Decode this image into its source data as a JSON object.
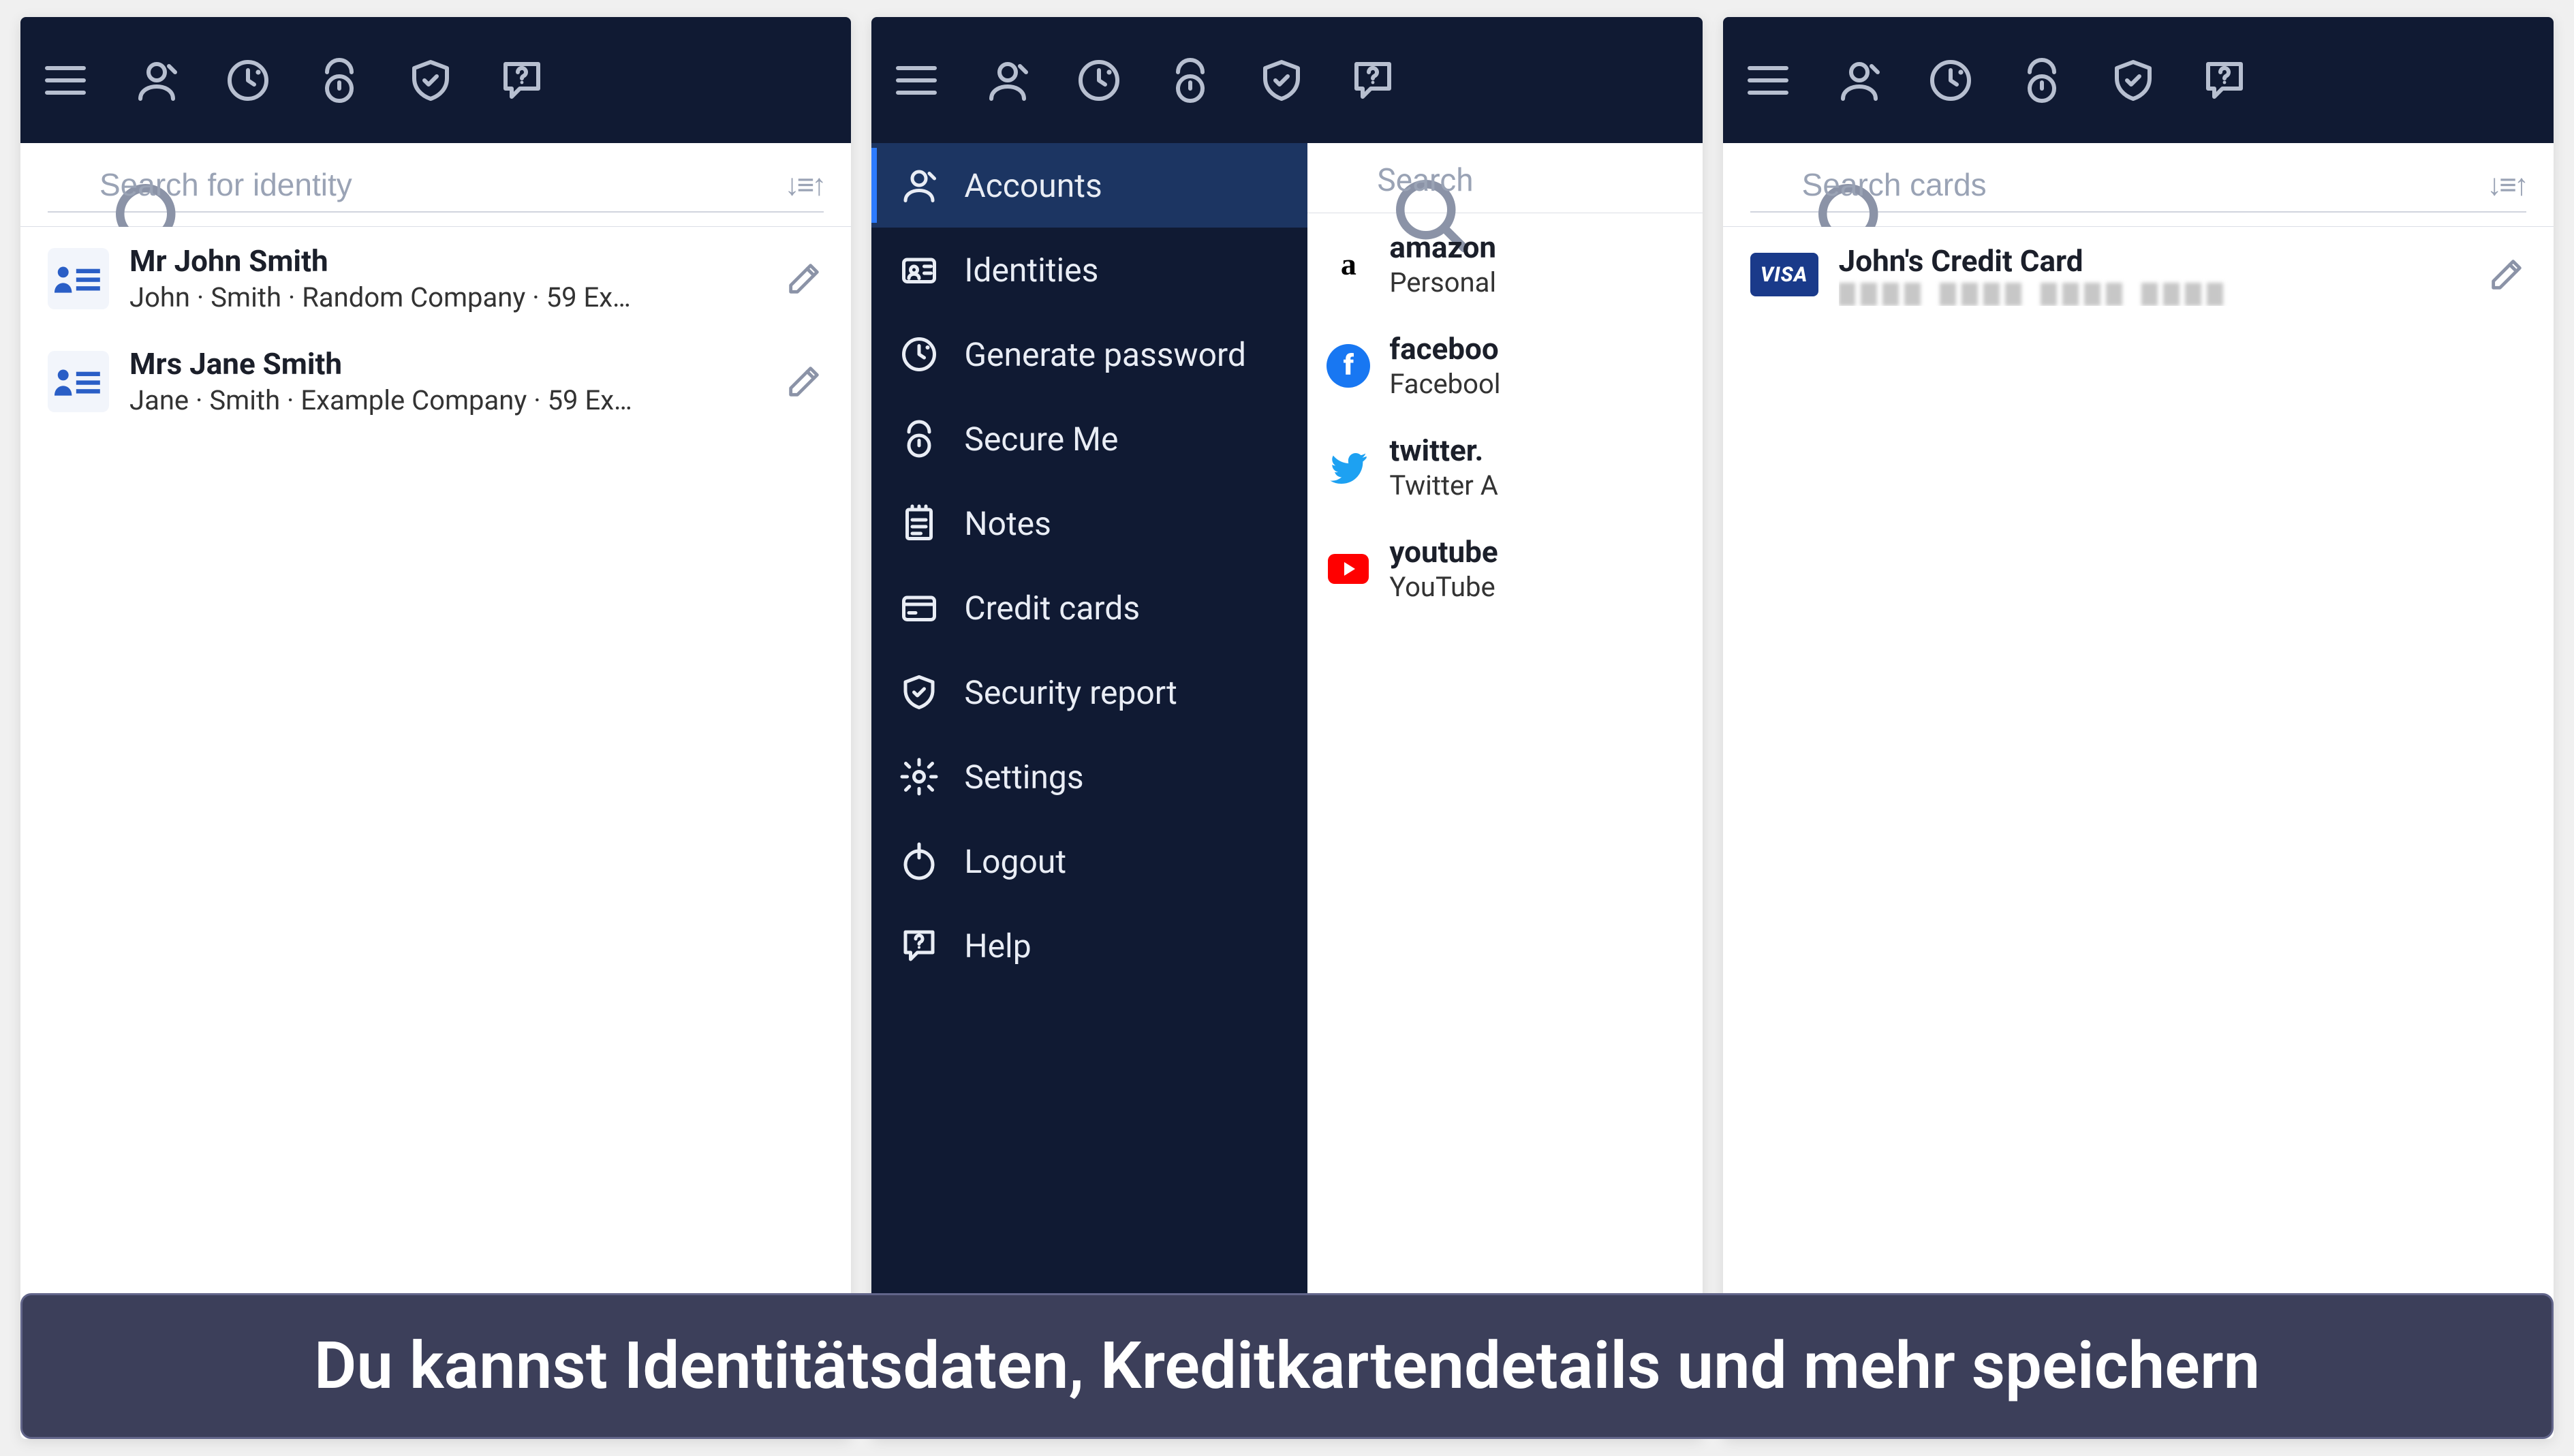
{
  "screen1": {
    "search_placeholder": "Search for identity",
    "identities": [
      {
        "title": "Mr John Smith",
        "subtitle": "John · Smith · Random Company · 59 Ex…"
      },
      {
        "title": "Mrs Jane Smith",
        "subtitle": "Jane · Smith · Example Company · 59 Ex…"
      }
    ]
  },
  "screen2": {
    "peek_search_placeholder": "Search",
    "menu": [
      {
        "label": "Accounts",
        "icon": "person",
        "active": true
      },
      {
        "label": "Identities",
        "icon": "idcard"
      },
      {
        "label": "Generate password",
        "icon": "generate"
      },
      {
        "label": "Secure Me",
        "icon": "secureme"
      },
      {
        "label": "Notes",
        "icon": "notes"
      },
      {
        "label": "Credit cards",
        "icon": "card"
      },
      {
        "label": "Security report",
        "icon": "shield"
      },
      {
        "label": "Settings",
        "icon": "gear"
      },
      {
        "label": "Logout",
        "icon": "logout"
      },
      {
        "label": "Help",
        "icon": "help"
      }
    ],
    "accounts": [
      {
        "logo": "amazon",
        "title": "amazon",
        "subtitle": "Personal"
      },
      {
        "logo": "fb",
        "title": "faceboo",
        "subtitle": "Facebool"
      },
      {
        "logo": "tw",
        "title": "twitter.",
        "subtitle": "Twitter A"
      },
      {
        "logo": "yt",
        "title": "youtube",
        "subtitle": "YouTube"
      }
    ]
  },
  "screen3": {
    "search_placeholder": "Search cards",
    "cards": [
      {
        "brand": "VISA",
        "title": "John's Credit Card"
      }
    ]
  },
  "caption": "Du kannst Identitätsdaten, Kreditkartendetails und mehr speichern"
}
